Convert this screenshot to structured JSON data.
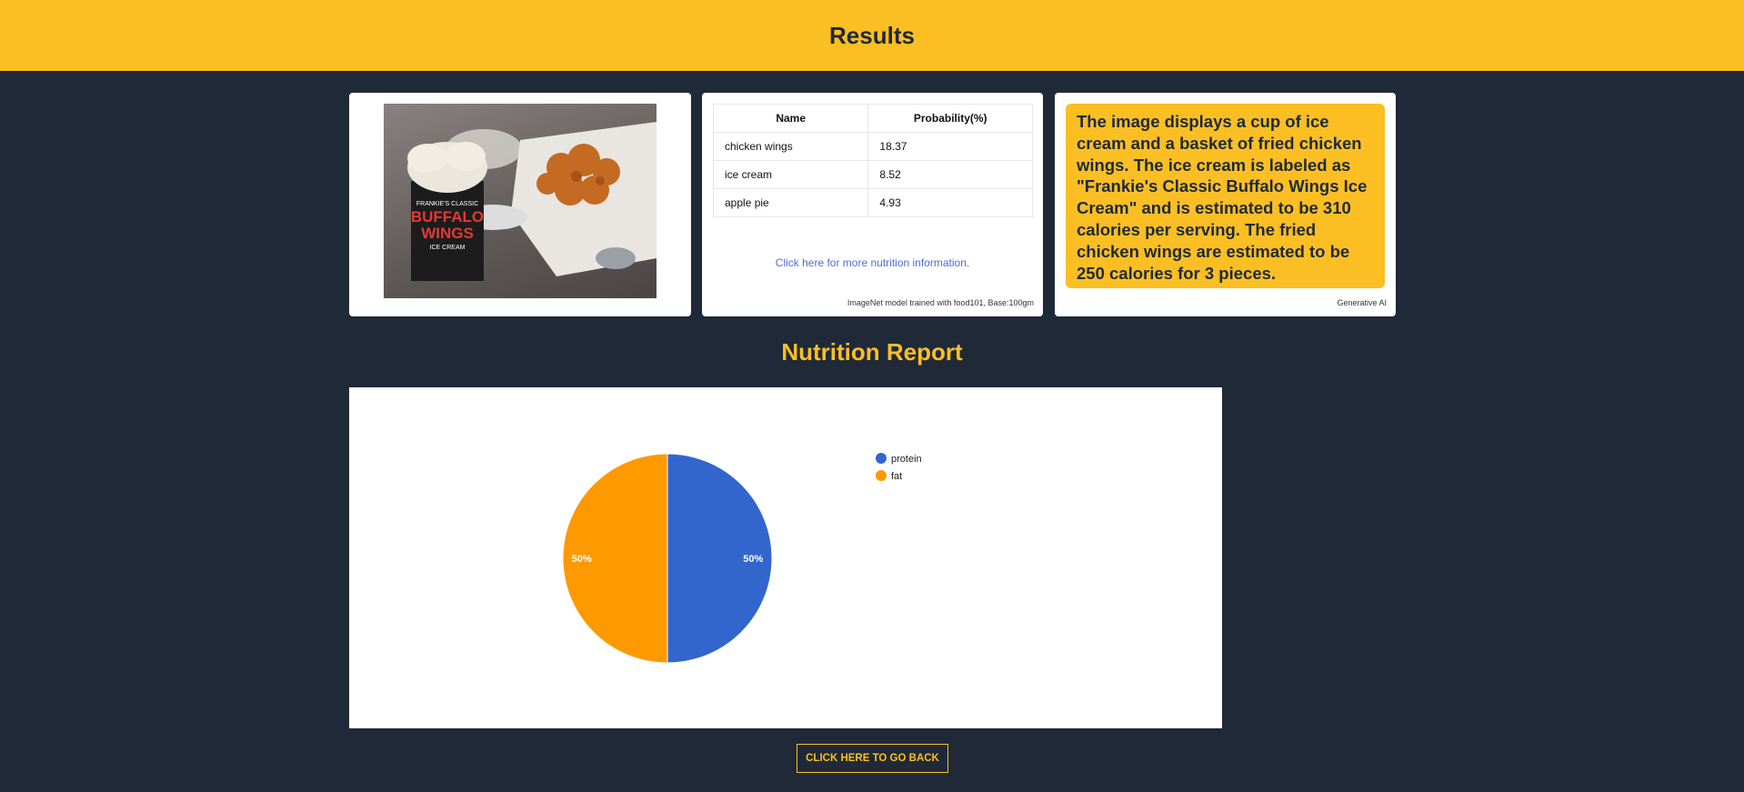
{
  "header": {
    "title": "Results"
  },
  "predictions": {
    "columns": [
      "Name",
      "Probability(%)"
    ],
    "rows": [
      [
        "chicken wings",
        "18.37"
      ],
      [
        "ice cream",
        "8.52"
      ],
      [
        "apple pie",
        "4.93"
      ]
    ],
    "link": "Click here for more nutrition information.",
    "footnote": "ImageNet model trained with food101, Base:100gm"
  },
  "ai": {
    "text": "The image displays a cup of ice cream and a basket of fried chicken wings. The ice cream is labeled as \"Frankie's Classic Buffalo Wings Ice Cream\" and is estimated to be 310 calories per serving. The fried chicken wings are estimated to be 250 calories for 3 pieces.",
    "footnote": "Generative AI"
  },
  "photo": {
    "label_lines": [
      "FRANKIE'S CLASSIC",
      "BUFFALO",
      "WINGS",
      "ICE CREAM"
    ]
  },
  "report": {
    "title": "Nutrition Report"
  },
  "chart_data": {
    "type": "pie",
    "categories": [
      "protein",
      "fat"
    ],
    "values": [
      50,
      50
    ],
    "labels": [
      "50%",
      "50%"
    ],
    "colors": [
      "#3366cc",
      "#ff9900"
    ],
    "legend": "right"
  },
  "back_button": "CLICK HERE TO GO BACK"
}
